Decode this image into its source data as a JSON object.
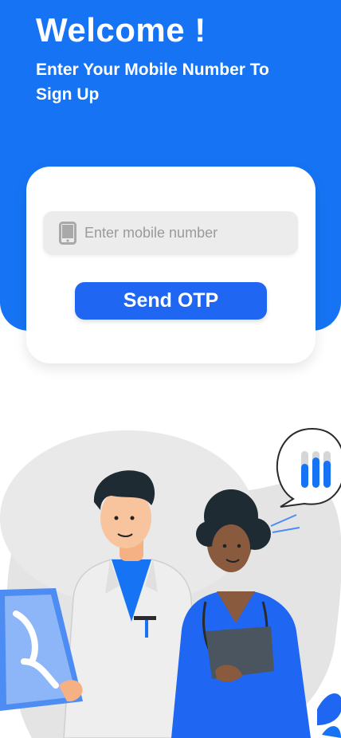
{
  "header": {
    "title": "Welcome !",
    "subtitle": "Enter Your Mobile Number To Sign Up"
  },
  "form": {
    "phone_placeholder": "Enter mobile number",
    "phone_value": "",
    "phone_icon": "phone-icon",
    "send_label": "Send OTP"
  },
  "colors": {
    "brand_blue": "#1674f4",
    "button_blue": "#1f66f2",
    "field_gray": "#ececec"
  },
  "illustration": {
    "subject": "doctor-and-nurse",
    "icons": [
      "xray-icon",
      "chart-bubble-icon",
      "tablet-icon",
      "stethoscope-icon"
    ]
  }
}
